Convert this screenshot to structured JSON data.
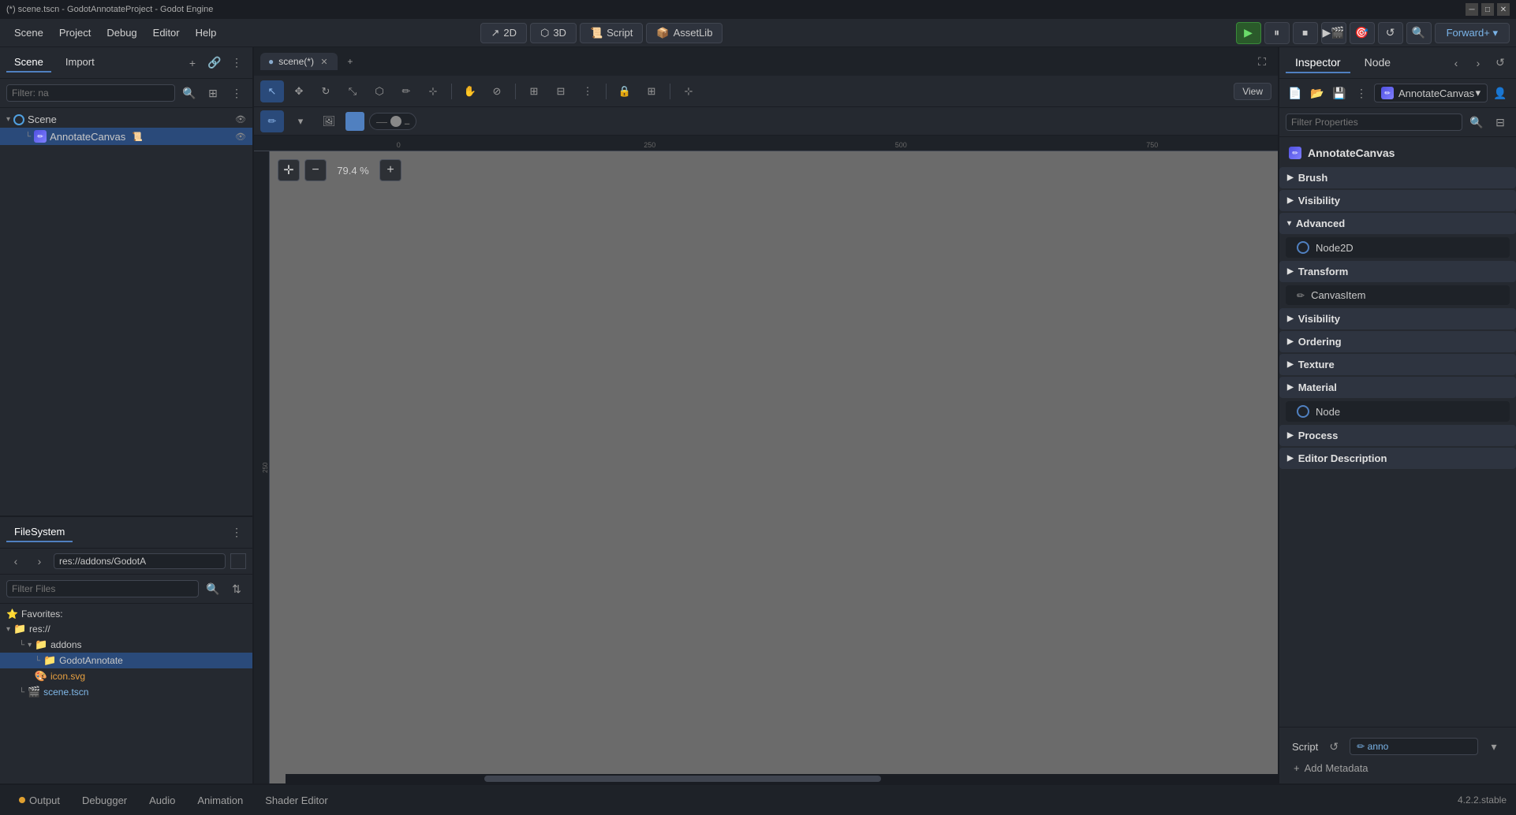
{
  "titlebar": {
    "title": "(*) scene.tscn - GodotAnnotateProject - Godot Engine",
    "min_btn": "─",
    "max_btn": "□",
    "close_btn": "✕"
  },
  "menubar": {
    "items": [
      {
        "label": "Scene"
      },
      {
        "label": "Project"
      },
      {
        "label": "Debug"
      },
      {
        "label": "Editor"
      },
      {
        "label": "Help"
      }
    ],
    "toolbar": {
      "btn_2d": "2D",
      "btn_3d": "3D",
      "btn_script": "Script",
      "btn_assetlib": "AssetLib"
    },
    "play": {
      "forward_label": "Forward+"
    }
  },
  "scene_panel": {
    "tab_scene": "Scene",
    "tab_import": "Import",
    "filter_placeholder": "Filter: na",
    "root_node": {
      "label": "Scene",
      "icon": "⬤"
    },
    "children": [
      {
        "label": "AnnotateCanvas",
        "icon": "✏"
      }
    ]
  },
  "filesystem_panel": {
    "title": "FileSystem",
    "path": "res://addons/GodotA",
    "filter_placeholder": "Filter Files",
    "favorites_label": "Favorites:",
    "tree": [
      {
        "label": "res://",
        "type": "folder",
        "icon": "📁",
        "indent": 0
      },
      {
        "label": "addons",
        "type": "folder",
        "icon": "📁",
        "indent": 1
      },
      {
        "label": "GodotAnnotate",
        "type": "folder",
        "icon": "📁",
        "indent": 2,
        "selected": true
      },
      {
        "label": "icon.svg",
        "type": "svg",
        "icon": "🖼",
        "indent": 2
      },
      {
        "label": "scene.tscn",
        "type": "tscn",
        "icon": "🎬",
        "indent": 1
      }
    ]
  },
  "editor": {
    "tab_label": "scene(*)",
    "zoom": "79.4 %",
    "view_btn": "View",
    "ruler_marks": [
      "",
      "250",
      "",
      "500",
      "",
      "750"
    ],
    "ruler_left_marks": [
      "250"
    ]
  },
  "bottom_panel": {
    "tabs": [
      {
        "label": "Output",
        "has_dot": true,
        "dot_color": "#e0a030"
      },
      {
        "label": "Debugger",
        "has_dot": false
      },
      {
        "label": "Audio",
        "has_dot": false
      },
      {
        "label": "Animation",
        "has_dot": false
      },
      {
        "label": "Shader Editor",
        "has_dot": false
      }
    ],
    "version": "4.2.2.stable"
  },
  "inspector": {
    "tab_inspector": "Inspector",
    "tab_node": "Node",
    "node_selector": "AnnotateCanvas",
    "filter_placeholder": "Filter Properties",
    "node_name": "AnnotateCanvas",
    "sections": [
      {
        "label": "Brush",
        "expanded": false,
        "children": []
      },
      {
        "label": "Visibility",
        "expanded": false,
        "children": []
      },
      {
        "label": "Advanced",
        "expanded": true,
        "children": [
          {
            "type": "subsection",
            "label": "Node2D",
            "icon": "circle"
          }
        ]
      },
      {
        "label": "Transform",
        "expanded": false,
        "children": []
      }
    ],
    "canvas_item_label": "CanvasItem",
    "canvas_item_sections": [
      {
        "label": "Visibility"
      },
      {
        "label": "Ordering"
      },
      {
        "label": "Texture"
      },
      {
        "label": "Material"
      }
    ],
    "node_subsection": "Node",
    "process_section": "Process",
    "editor_desc_section": "Editor Description",
    "script_label": "Script",
    "script_value": "anno",
    "add_meta_label": "Add Metadata"
  }
}
